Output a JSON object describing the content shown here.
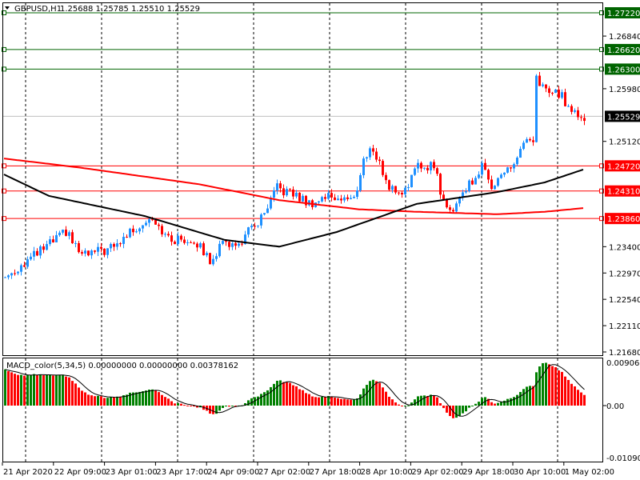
{
  "header": {
    "symbol": "GBPUSD,H1",
    "ohlc": "1.25688 1.25785 1.25510 1.25529"
  },
  "indicator": {
    "label": "MACD_color(5,34,5) 0.00000000 0.00000000 0.00378162",
    "top": "0.0090664",
    "zero": "0.00",
    "bottom": "-0.010905"
  },
  "price_axis": [
    "1.26840",
    "1.25980",
    "1.25120",
    "1.23400",
    "1.22970",
    "1.22540",
    "1.22110",
    "1.21680"
  ],
  "price_axis_values": [
    1.2684,
    1.2598,
    1.2512,
    1.234,
    1.2297,
    1.2254,
    1.2211,
    1.2168
  ],
  "levels": [
    {
      "label": "1.27220",
      "value": 1.2722,
      "color": "#006400"
    },
    {
      "label": "1.26620",
      "value": 1.2662,
      "color": "#006400"
    },
    {
      "label": "1.26300",
      "value": 1.263,
      "color": "#006400"
    },
    {
      "label": "1.24720",
      "value": 1.2472,
      "color": "#ff0000"
    },
    {
      "label": "1.24310",
      "value": 1.2431,
      "color": "#ff0000"
    },
    {
      "label": "1.23860",
      "value": 1.2386,
      "color": "#ff0000"
    }
  ],
  "current_price": {
    "label": "1.25529",
    "value": 1.25529
  },
  "time_axis": [
    "21 Apr 2020",
    "22 Apr 09:00",
    "23 Apr 01:00",
    "23 Apr 17:00",
    "24 Apr 09:00",
    "27 Apr 02:00",
    "27 Apr 18:00",
    "28 Apr 10:00",
    "29 Apr 02:00",
    "29 Apr 18:00",
    "30 Apr 10:00",
    "1 May 02:00"
  ],
  "colors": {
    "bull": "#1e90ff",
    "bear": "#ff0000",
    "ma_slow": "#ff0000",
    "ma_fast": "#000000",
    "macd_up": "#008000",
    "macd_down": "#ff0000",
    "grid": "#000000"
  },
  "price_path": [
    [
      0,
      1.229
    ],
    [
      19,
      1.2364
    ],
    [
      24,
      1.2325
    ],
    [
      34,
      1.2338
    ],
    [
      39,
      1.2364
    ],
    [
      46,
      1.239
    ],
    [
      51,
      1.2351
    ],
    [
      59,
      1.2351
    ],
    [
      64,
      1.2318
    ],
    [
      69,
      1.2351
    ],
    [
      72,
      1.2338
    ],
    [
      76,
      1.2364
    ],
    [
      81,
      1.239
    ],
    [
      85,
      1.2436
    ],
    [
      91,
      1.2423
    ],
    [
      95,
      1.241
    ],
    [
      101,
      1.2423
    ],
    [
      109,
      1.2416
    ],
    [
      112,
      1.2482
    ],
    [
      115,
      1.2501
    ],
    [
      120,
      1.2436
    ],
    [
      124,
      1.2429
    ],
    [
      129,
      1.2469
    ],
    [
      134,
      1.2475
    ],
    [
      137,
      1.241
    ],
    [
      139,
      1.2397
    ],
    [
      144,
      1.2436
    ],
    [
      149,
      1.2469
    ],
    [
      152,
      1.2442
    ],
    [
      159,
      1.2475
    ],
    [
      162,
      1.2508
    ],
    [
      165,
      1.2508
    ],
    [
      166,
      1.2612
    ],
    [
      170,
      1.2593
    ],
    [
      174,
      1.2586
    ],
    [
      177,
      1.256
    ],
    [
      181,
      1.2553
    ]
  ],
  "ma_slow_path": [
    [
      0,
      1.2484
    ],
    [
      24,
      1.2469
    ],
    [
      61,
      1.2442
    ],
    [
      86,
      1.2416
    ],
    [
      111,
      1.2401
    ],
    [
      129,
      1.2397
    ],
    [
      154,
      1.2393
    ],
    [
      169,
      1.2397
    ],
    [
      181,
      1.2403
    ]
  ],
  "ma_fast_path": [
    [
      0,
      1.2458
    ],
    [
      14,
      1.2423
    ],
    [
      44,
      1.239
    ],
    [
      69,
      1.2351
    ],
    [
      86,
      1.234
    ],
    [
      104,
      1.2364
    ],
    [
      129,
      1.241
    ],
    [
      154,
      1.2429
    ],
    [
      169,
      1.2445
    ],
    [
      181,
      1.2466
    ]
  ]
}
